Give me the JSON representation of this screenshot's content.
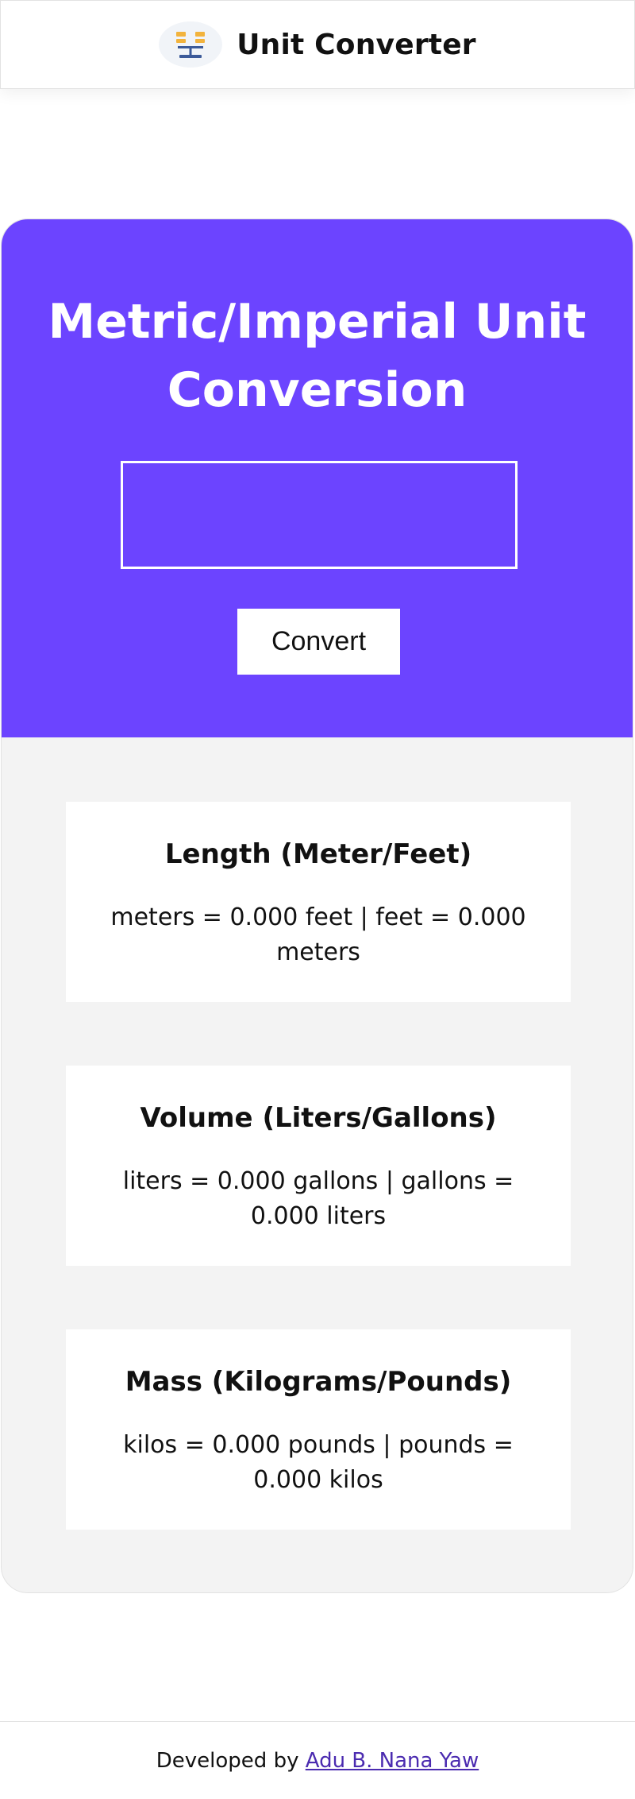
{
  "header": {
    "logo_icon": "scale-balance-icon",
    "title": "Unit Converter"
  },
  "hero": {
    "title": "Metric/Imperial Unit Conversion",
    "input_value": "",
    "convert_label": "Convert",
    "background_color": "#6c44ff"
  },
  "results": [
    {
      "title": "Length (Meter/Feet)",
      "text": "meters = 0.000 feet | feet = 0.000 meters"
    },
    {
      "title": "Volume (Liters/Gallons)",
      "text": "liters = 0.000 gallons | gallons = 0.000 liters"
    },
    {
      "title": "Mass (Kilograms/Pounds)",
      "text": "kilos = 0.000 pounds | pounds = 0.000 kilos"
    }
  ],
  "footer": {
    "prefix": "Developed by",
    "author_link": "Adu B. Nana Yaw"
  }
}
